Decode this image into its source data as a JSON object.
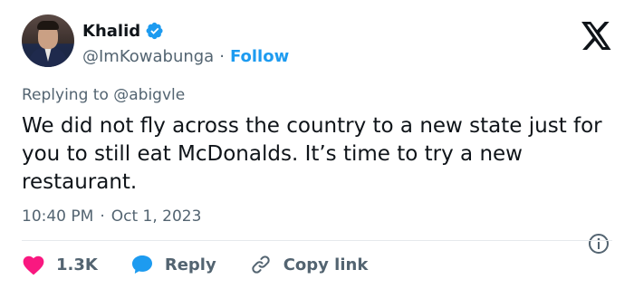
{
  "author": {
    "name": "Khalid",
    "handle": "@ImKowabunga",
    "separator": "·",
    "follow_label": "Follow"
  },
  "tweet": {
    "replying_to": "Replying to @abigvle",
    "text": "We did not fly across the country to a new state just for you to still eat McDonalds. It’s time to try a new restaurant.",
    "time": "10:40 PM",
    "separator": "·",
    "date": "Oct 1, 2023"
  },
  "actions": {
    "like_count": "1.3K",
    "reply_label": "Reply",
    "copy_label": "Copy link"
  },
  "icons": {
    "verified": "verified-badge-icon",
    "brand": "x-logo-icon",
    "info": "info-icon",
    "like": "heart-icon",
    "reply": "speech-bubble-icon",
    "copy": "link-icon"
  },
  "colors": {
    "accent": "#1d9bf0",
    "like": "#f91880",
    "text": "#0f1419",
    "muted": "#536471"
  }
}
